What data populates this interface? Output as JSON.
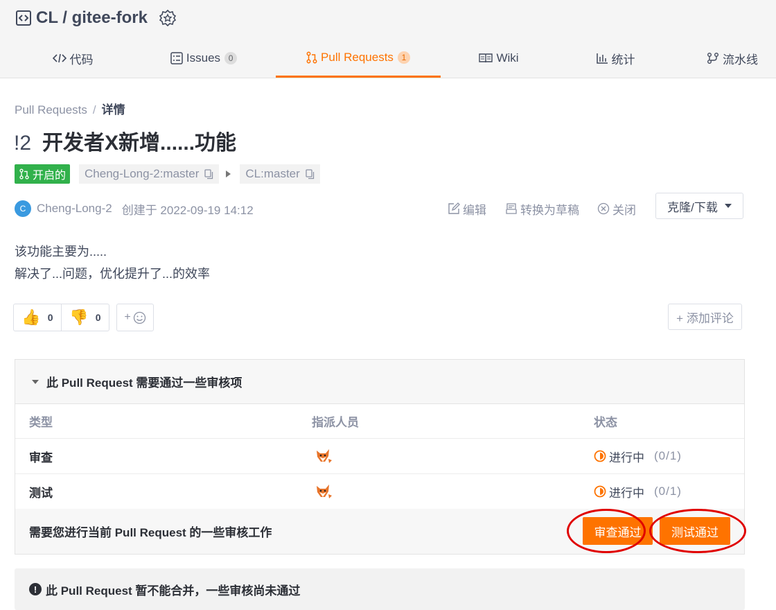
{
  "repo": {
    "title": "CL / gitee-fork"
  },
  "tabs": [
    {
      "label": "代码",
      "count": ""
    },
    {
      "label": "Issues",
      "count": "0"
    },
    {
      "label": "Pull Requests",
      "count": "1"
    },
    {
      "label": "Wiki",
      "count": ""
    },
    {
      "label": "统计",
      "count": ""
    },
    {
      "label": "流水线",
      "count": ""
    }
  ],
  "breadcrumb": {
    "parent": "Pull Requests",
    "separator": "/",
    "current": "详情"
  },
  "pr": {
    "number": "!2",
    "title": "开发者X新增......功能",
    "status": "开启的",
    "source_branch": "Cheng-Long-2:master",
    "target_branch": "CL:master",
    "author_initial": "C",
    "author": "Cheng-Long-2",
    "created": "创建于 2022-09-19 14:12",
    "description": [
      "该功能主要为.....",
      "解决了...问题，优化提升了...的效率"
    ]
  },
  "actions": {
    "edit": "编辑",
    "draft": "转换为草稿",
    "close": "关闭",
    "clone": "克隆/下载"
  },
  "reactions": {
    "thumbs_up": "0",
    "thumbs_down": "0",
    "add_emoji": "+",
    "add_comment": "+ 添加评论"
  },
  "review": {
    "heading": "此 Pull Request 需要通过一些审核项",
    "columns": [
      "类型",
      "指派人员",
      "状态"
    ],
    "rows": [
      {
        "type": "审查",
        "status": "进行中",
        "ratio": "(0/1)"
      },
      {
        "type": "测试",
        "status": "进行中",
        "ratio": "(0/1)"
      }
    ],
    "footer_message": "需要您进行当前 Pull Request 的一些审核工作",
    "approve_review": "审查通过",
    "approve_test": "测试通过"
  },
  "merge_notice": "此 Pull Request 暂不能合并，一些审核尚未通过",
  "colors": {
    "accent": "#fe7300",
    "open_green": "#31b14b",
    "annotation_red": "#e00000"
  }
}
